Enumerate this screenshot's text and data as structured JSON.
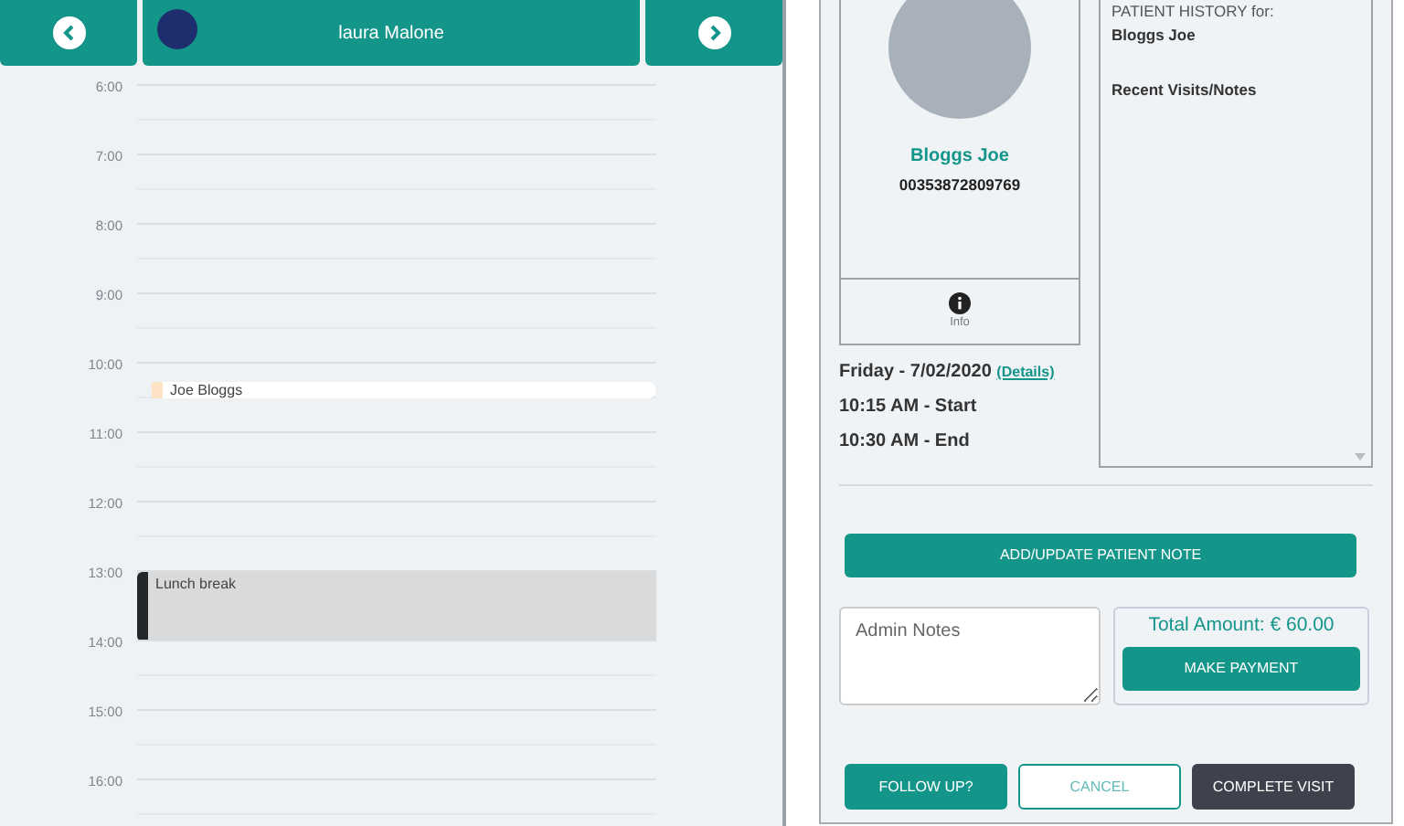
{
  "calendar": {
    "practitioner": "laura Malone",
    "hours": [
      {
        "label": "6:00"
      },
      {
        "label": "7:00"
      },
      {
        "label": "8:00"
      },
      {
        "label": "9:00"
      },
      {
        "label": "10:00",
        "events": [
          {
            "kind": "appointment",
            "title": "Joe Bloggs",
            "color": "#fde3c4"
          }
        ]
      },
      {
        "label": "11:00"
      },
      {
        "label": "12:00"
      },
      {
        "label": "13:00",
        "events": [
          {
            "kind": "break",
            "title": "Lunch break",
            "color": "#23262b"
          }
        ]
      },
      {
        "label": "14:00"
      },
      {
        "label": "15:00"
      },
      {
        "label": "16:00"
      }
    ]
  },
  "patient": {
    "name": "Bloggs Joe",
    "phone": "00353872809769",
    "info_label": "Info"
  },
  "history": {
    "title": "PATIENT HISTORY for:",
    "patient": "Bloggs Joe",
    "section": "Recent Visits/Notes"
  },
  "appointment": {
    "date": "Friday - 7/02/2020",
    "details_link": "(Details)",
    "start": "10:15 AM - Start",
    "end": "10:30 AM - End"
  },
  "add_note_button": "ADD/UPDATE PATIENT NOTE",
  "admin_notes": {
    "placeholder": "Admin Notes"
  },
  "payment": {
    "total": "Total Amount: € 60.00",
    "button": "MAKE PAYMENT"
  },
  "actions": [
    {
      "kind": "primary",
      "label": "FOLLOW UP?"
    },
    {
      "kind": "outline",
      "label": "CANCEL"
    },
    {
      "kind": "dark",
      "label": "COMPLETE VISIT"
    }
  ]
}
